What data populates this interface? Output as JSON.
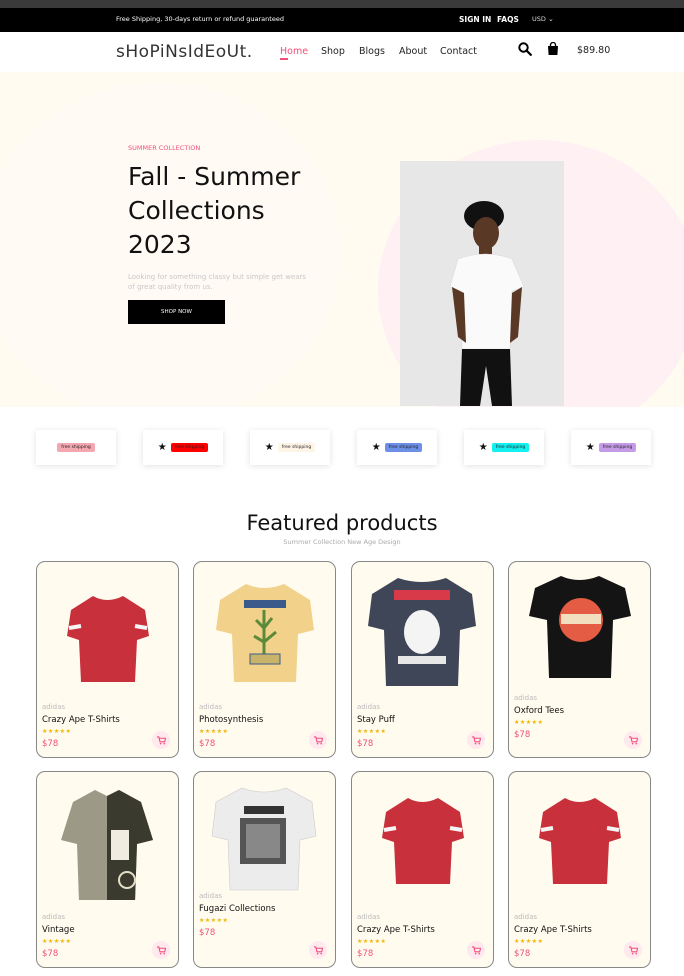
{
  "topbar": {
    "shipping_text": "Free Shipping, 30-days return or refund guaranteed",
    "signin": "SIGN IN",
    "faqs": "FAQS",
    "currency": "USD"
  },
  "nav": {
    "logo": "sHoPiNsIdEoUt.",
    "items": [
      "Home",
      "Shop",
      "Blogs",
      "About",
      "Contact"
    ],
    "active": "Home",
    "cart_total": "$89.80"
  },
  "hero": {
    "kicker": "SUMMER COLLECTION",
    "title_line1": "Fall - Summer",
    "title_line2": "Collections",
    "title_line3": "2023",
    "description": "Looking for something classy but simple get wears of great quality from us.",
    "button": "SHOP NOW"
  },
  "badges": [
    {
      "label": "free shipping",
      "color": "#f4a7b1",
      "star": false
    },
    {
      "label": "free shipping",
      "color": "#ff0000",
      "star": true
    },
    {
      "label": "free shipping",
      "color": "#fff5e6",
      "star": true
    },
    {
      "label": "free shipping",
      "color": "#6d8fe8",
      "star": true
    },
    {
      "label": "free shipping",
      "color": "#12f0f0",
      "star": true
    },
    {
      "label": "free shipping",
      "color": "#c59be8",
      "star": true
    }
  ],
  "featured": {
    "title": "Featured products",
    "subtitle": "Summer Collection New Age Design"
  },
  "products": [
    {
      "brand": "adidas",
      "name": "Crazy Ape T-Shirts",
      "price": "$78",
      "rating": 5,
      "image": "red-tshirt"
    },
    {
      "brand": "adidas",
      "name": "Photosynthesis",
      "price": "$78",
      "rating": 5,
      "image": "yellow-photosynthesis-tshirt"
    },
    {
      "brand": "adidas",
      "name": "Stay Puff",
      "price": "$78",
      "rating": 5,
      "image": "stay-puft-tshirt"
    },
    {
      "brand": "adidas",
      "name": "Oxford Tees",
      "price": "$78",
      "rating": 5,
      "image": "oxford-comma-tshirt"
    },
    {
      "brand": "adidas",
      "name": "Vintage",
      "price": "$78",
      "rating": 5,
      "image": "vintage-shirt"
    },
    {
      "brand": "adidas",
      "name": "Fugazi Collections",
      "price": "$78",
      "rating": 5,
      "image": "fugazi-tshirt"
    },
    {
      "brand": "adidas",
      "name": "Crazy Ape T-Shirts",
      "price": "$78",
      "rating": 5,
      "image": "red-tshirt"
    },
    {
      "brand": "adidas",
      "name": "Crazy Ape T-Shirts",
      "price": "$78",
      "rating": 5,
      "image": "red-tshirt"
    }
  ],
  "colors": {
    "accent": "#f0507a",
    "star": "#f2b600",
    "card_bg": "#fffbef"
  }
}
